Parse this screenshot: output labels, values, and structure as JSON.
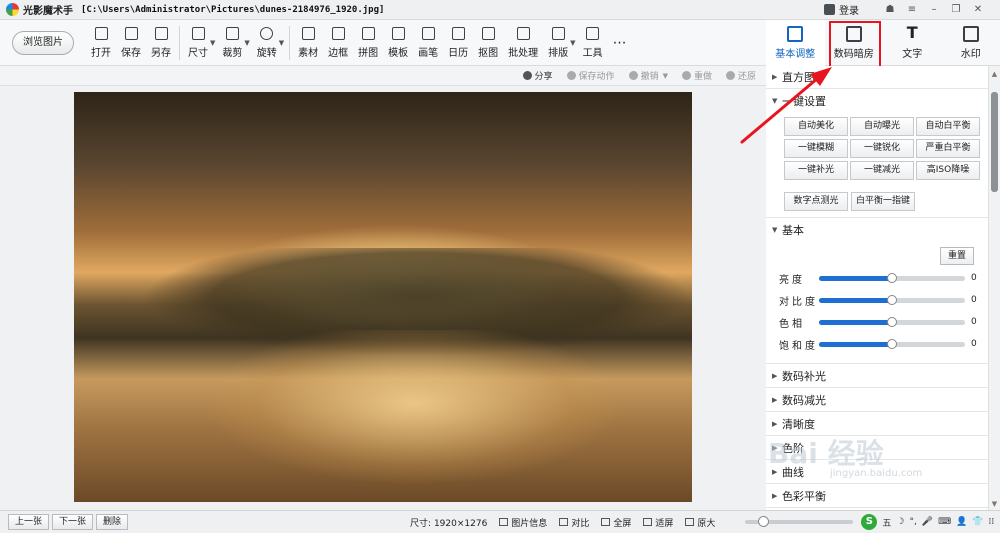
{
  "titlebar": {
    "app_name": "光影魔术手",
    "file_path": "[C:\\Users\\Administrator\\Pictures\\dunes-2184976_1920.jpg]",
    "login": "登录",
    "controls": [
      "☗",
      "≡",
      "–",
      "❐",
      "✕"
    ]
  },
  "toolbar": {
    "browse_label": "浏览图片",
    "tools": [
      {
        "label": "打开",
        "icon": "open-icon"
      },
      {
        "label": "保存",
        "icon": "save-icon"
      },
      {
        "label": "另存",
        "icon": "save-as-icon"
      },
      {
        "label": "尺寸",
        "icon": "resize-icon",
        "caret": true
      },
      {
        "label": "裁剪",
        "icon": "crop-icon",
        "caret": true
      },
      {
        "label": "旋转",
        "icon": "rotate-icon",
        "caret": true
      },
      {
        "label": "素材",
        "icon": "material-icon"
      },
      {
        "label": "边框",
        "icon": "border-icon"
      },
      {
        "label": "拼图",
        "icon": "collage-icon"
      },
      {
        "label": "模板",
        "icon": "template-icon"
      },
      {
        "label": "画笔",
        "icon": "brush-icon"
      },
      {
        "label": "日历",
        "icon": "calendar-icon"
      },
      {
        "label": "抠图",
        "icon": "cutout-icon"
      },
      {
        "label": "批处理",
        "icon": "batch-icon"
      },
      {
        "label": "排版",
        "icon": "layout-icon",
        "caret": true
      },
      {
        "label": "工具",
        "icon": "tools-icon"
      }
    ],
    "more": "⋯"
  },
  "tabs": [
    {
      "label": "基本调整",
      "icon": "adjust-icon",
      "active": true
    },
    {
      "label": "数码暗房",
      "icon": "camera-icon",
      "active": false
    },
    {
      "label": "文字",
      "icon": "text-icon",
      "active": false
    },
    {
      "label": "水印",
      "icon": "watermark-icon",
      "active": false
    }
  ],
  "actions": [
    {
      "label": "分享",
      "enabled": true,
      "dropdown": false
    },
    {
      "label": "保存动作",
      "enabled": false,
      "dropdown": false
    },
    {
      "label": "撤销",
      "enabled": false,
      "dropdown": true
    },
    {
      "label": "重做",
      "enabled": false,
      "dropdown": false
    },
    {
      "label": "还原",
      "enabled": false,
      "dropdown": false
    }
  ],
  "panel": {
    "histogram": "直方图",
    "oneclick": {
      "title": "一键设置",
      "buttons": [
        "自动美化",
        "自动曝光",
        "自动白平衡",
        "一键模糊",
        "一键锐化",
        "严重白平衡",
        "一键补光",
        "一键减光",
        "高ISO降噪"
      ],
      "buttons2": [
        "数字点测光",
        "白平衡一指键"
      ]
    },
    "basic": {
      "title": "基本",
      "reset": "重置",
      "sliders": [
        {
          "label": "亮度",
          "value": "0",
          "level": 0.5
        },
        {
          "label": "对比度",
          "value": "0",
          "level": 0.5
        },
        {
          "label": "色相",
          "value": "0",
          "level": 0.5
        },
        {
          "label": "饱和度",
          "value": "0",
          "level": 0.5
        }
      ]
    },
    "collapsed": [
      "数码补光",
      "数码减光",
      "清晰度",
      "色阶",
      "曲线",
      "色彩平衡"
    ]
  },
  "bottombar": {
    "nav": [
      "上一张",
      "下一张",
      "删除"
    ],
    "size": "尺寸: 1920×1276",
    "actions": [
      "图片信息",
      "对比",
      "全屏",
      "适屏",
      "原大"
    ],
    "zoom_level": 0.12,
    "ime": [
      "S",
      "五",
      "☽",
      "°,",
      "🎤",
      "⌨",
      "👤",
      "👕",
      "⁞⁞"
    ]
  },
  "watermark": {
    "text": "Bai 经验",
    "url": "jingyan.baidu.com"
  },
  "colors": {
    "accent": "#1565c0",
    "highlight": "#e8141f",
    "slider": "#1e6fd1"
  }
}
